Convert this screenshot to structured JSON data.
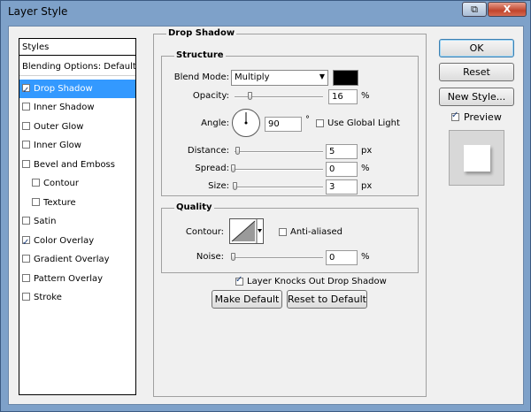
{
  "window": {
    "title": "Layer Style",
    "restore_glyph": "⧉",
    "close_glyph": "X"
  },
  "styles": {
    "header": "Styles",
    "items": [
      {
        "label": "Blending Options: Default"
      },
      {
        "label": "Drop Shadow",
        "checked": true,
        "selected": true
      },
      {
        "label": "Inner Shadow"
      },
      {
        "label": "Outer Glow"
      },
      {
        "label": "Inner Glow"
      },
      {
        "label": "Bevel and Emboss"
      },
      {
        "label": "Contour"
      },
      {
        "label": "Texture"
      },
      {
        "label": "Satin"
      },
      {
        "label": "Color Overlay",
        "checked": true
      },
      {
        "label": "Gradient Overlay"
      },
      {
        "label": "Pattern Overlay"
      },
      {
        "label": "Stroke"
      }
    ]
  },
  "drop_shadow": {
    "title": "Drop Shadow",
    "structure": {
      "title": "Structure",
      "blend_mode_label": "Blend Mode:",
      "blend_mode_value": "Multiply",
      "color": "#000000",
      "opacity_label": "Opacity:",
      "opacity_value": "16",
      "opacity_unit": "%",
      "angle_label": "Angle:",
      "angle_value": "90",
      "angle_unit": "°",
      "global_light_label": "Use Global Light",
      "distance_label": "Distance:",
      "distance_value": "5",
      "distance_unit": "px",
      "spread_label": "Spread:",
      "spread_value": "0",
      "spread_unit": "%",
      "size_label": "Size:",
      "size_value": "3",
      "size_unit": "px"
    },
    "quality": {
      "title": "Quality",
      "contour_label": "Contour:",
      "anti_aliased_label": "Anti-aliased",
      "noise_label": "Noise:",
      "noise_value": "0",
      "noise_unit": "%"
    },
    "knocks_out_label": "Layer Knocks Out Drop Shadow",
    "make_default_label": "Make Default",
    "reset_default_label": "Reset to Default"
  },
  "buttons": {
    "ok": "OK",
    "reset": "Reset",
    "new_style": "New Style...",
    "preview": "Preview"
  },
  "colors": {
    "selected": "#3399ff",
    "frame": "#7ea1c9"
  }
}
